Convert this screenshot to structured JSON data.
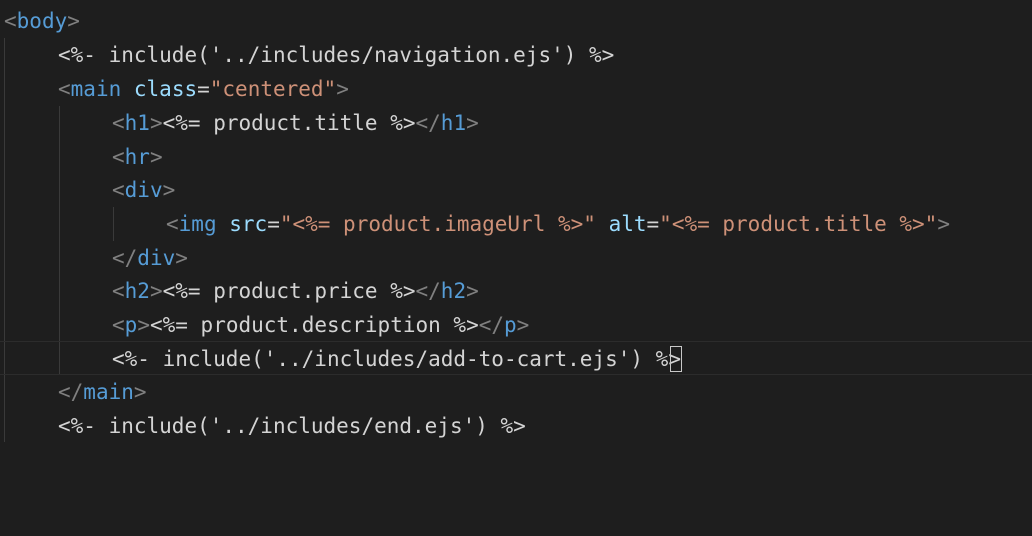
{
  "editor": {
    "lines": [
      {
        "segments": [
          {
            "t": "punct",
            "v": "<"
          },
          {
            "t": "tag",
            "v": "body"
          },
          {
            "t": "punct",
            "v": ">"
          }
        ]
      },
      {
        "segments": [
          {
            "t": "delim",
            "v": "<%-"
          },
          {
            "t": "code",
            "v": " include('../includes/navigation.ejs') "
          },
          {
            "t": "delim",
            "v": "%>"
          }
        ]
      },
      {
        "segments": [
          {
            "t": "punct",
            "v": "<"
          },
          {
            "t": "tag",
            "v": "main"
          },
          {
            "t": "code",
            "v": " "
          },
          {
            "t": "attr",
            "v": "class"
          },
          {
            "t": "code",
            "v": "="
          },
          {
            "t": "str",
            "v": "\"centered\""
          },
          {
            "t": "punct",
            "v": ">"
          }
        ]
      },
      {
        "segments": [
          {
            "t": "punct",
            "v": "<"
          },
          {
            "t": "tag",
            "v": "h1"
          },
          {
            "t": "punct",
            "v": ">"
          },
          {
            "t": "delim",
            "v": "<%="
          },
          {
            "t": "code",
            "v": " product.title "
          },
          {
            "t": "delim",
            "v": "%>"
          },
          {
            "t": "punct",
            "v": "</"
          },
          {
            "t": "tag",
            "v": "h1"
          },
          {
            "t": "punct",
            "v": ">"
          }
        ]
      },
      {
        "segments": [
          {
            "t": "punct",
            "v": "<"
          },
          {
            "t": "tag",
            "v": "hr"
          },
          {
            "t": "punct",
            "v": ">"
          }
        ]
      },
      {
        "segments": [
          {
            "t": "punct",
            "v": "<"
          },
          {
            "t": "tag",
            "v": "div"
          },
          {
            "t": "punct",
            "v": ">"
          }
        ]
      },
      {
        "segments": [
          {
            "t": "punct",
            "v": "<"
          },
          {
            "t": "tag",
            "v": "img"
          },
          {
            "t": "code",
            "v": " "
          },
          {
            "t": "attr",
            "v": "src"
          },
          {
            "t": "code",
            "v": "="
          },
          {
            "t": "str",
            "v": "\"<%= product.imageUrl %>\""
          },
          {
            "t": "code",
            "v": " "
          },
          {
            "t": "attr",
            "v": "alt"
          },
          {
            "t": "code",
            "v": "="
          },
          {
            "t": "str",
            "v": "\"<%= product.title %>\""
          },
          {
            "t": "punct",
            "v": ">"
          }
        ]
      },
      {
        "segments": [
          {
            "t": "punct",
            "v": "</"
          },
          {
            "t": "tag",
            "v": "div"
          },
          {
            "t": "punct",
            "v": ">"
          }
        ]
      },
      {
        "segments": [
          {
            "t": "punct",
            "v": "<"
          },
          {
            "t": "tag",
            "v": "h2"
          },
          {
            "t": "punct",
            "v": ">"
          },
          {
            "t": "delim",
            "v": "<%="
          },
          {
            "t": "code",
            "v": " product.price "
          },
          {
            "t": "delim",
            "v": "%>"
          },
          {
            "t": "punct",
            "v": "</"
          },
          {
            "t": "tag",
            "v": "h2"
          },
          {
            "t": "punct",
            "v": ">"
          }
        ]
      },
      {
        "segments": [
          {
            "t": "punct",
            "v": "<"
          },
          {
            "t": "tag",
            "v": "p"
          },
          {
            "t": "punct",
            "v": ">"
          },
          {
            "t": "delim",
            "v": "<%="
          },
          {
            "t": "code",
            "v": " product.description "
          },
          {
            "t": "delim",
            "v": "%>"
          },
          {
            "t": "punct",
            "v": "</"
          },
          {
            "t": "tag",
            "v": "p"
          },
          {
            "t": "punct",
            "v": ">"
          }
        ]
      },
      {
        "segments": [
          {
            "t": "delim",
            "v": "<%-"
          },
          {
            "t": "code",
            "v": " include('../includes/add-to-cart.ejs') "
          },
          {
            "t": "delim",
            "v": "%>"
          }
        ]
      },
      {
        "segments": [
          {
            "t": "punct",
            "v": "</"
          },
          {
            "t": "tag",
            "v": "main"
          },
          {
            "t": "punct",
            "v": ">"
          }
        ]
      },
      {
        "segments": [
          {
            "t": "delim",
            "v": "<%-"
          },
          {
            "t": "code",
            "v": " include('../includes/end.ejs') "
          },
          {
            "t": "delim",
            "v": "%>"
          }
        ]
      }
    ]
  }
}
